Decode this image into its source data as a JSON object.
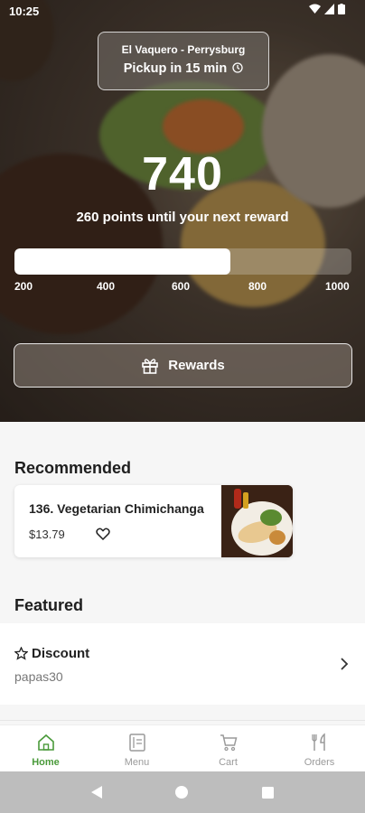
{
  "status": {
    "time": "10:25"
  },
  "location": {
    "name": "El Vaquero - Perrysburg",
    "pickup": "Pickup in 15 min",
    "pickup_icon": "clock-icon"
  },
  "rewards": {
    "points": "740",
    "until_text": "260 points until your next reward",
    "progress_fraction": 0.64,
    "ticks": [
      "200",
      "400",
      "600",
      "800",
      "1000"
    ],
    "button_label": "Rewards",
    "button_icon": "gift-icon"
  },
  "recommended": {
    "title": "Recommended",
    "items": [
      {
        "name": "136. Vegetarian Chimichanga",
        "price": "$13.79",
        "icon": "heart-icon"
      }
    ]
  },
  "featured": {
    "title": "Featured",
    "items": [
      {
        "title": "Discount",
        "code": "papas30",
        "icon": "star-icon"
      }
    ]
  },
  "nav": {
    "items": [
      {
        "label": "Home",
        "icon": "home-icon",
        "active": true
      },
      {
        "label": "Menu",
        "icon": "menu-icon",
        "active": false
      },
      {
        "label": "Cart",
        "icon": "cart-icon",
        "active": false
      },
      {
        "label": "Orders",
        "icon": "orders-icon",
        "active": false
      }
    ]
  },
  "colors": {
    "accent": "#4a9a3a",
    "nav_inactive": "#9a9a9a"
  }
}
